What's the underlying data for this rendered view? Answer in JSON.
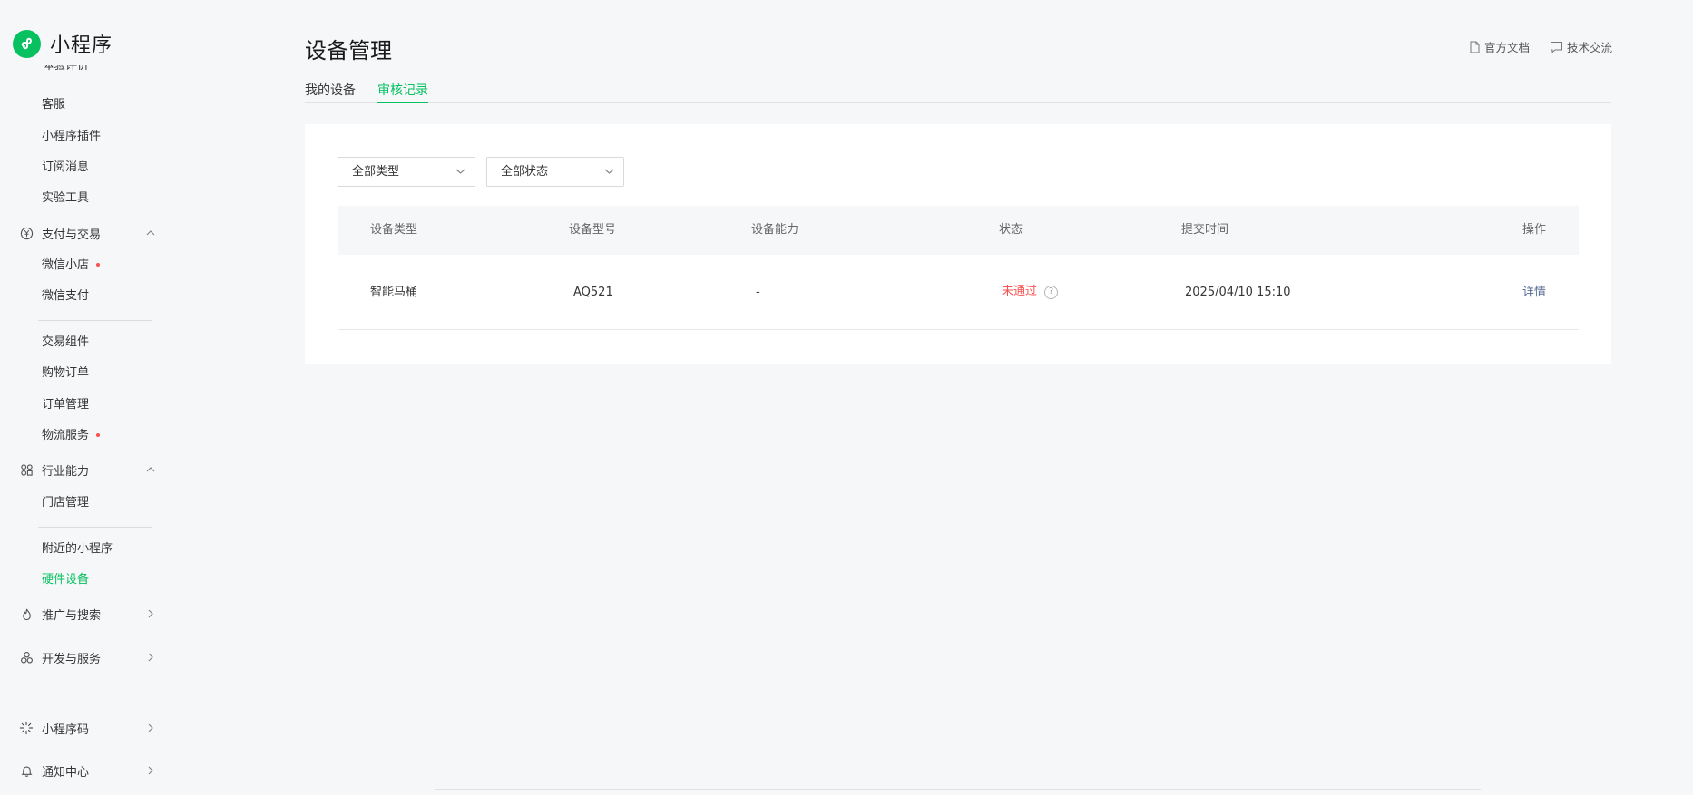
{
  "app": {
    "name": "小程序",
    "brand_color": "#07c160"
  },
  "sidebar": {
    "clipped_item": "体验评价",
    "items": {
      "kefu": "客服",
      "plugin": "小程序插件",
      "subscribe": "订阅消息",
      "lab": "实验工具",
      "shop": "微信小店",
      "pay": "微信支付",
      "trade_component": "交易组件",
      "shopping_order": "购物订单",
      "order_mgmt": "订单管理",
      "logistics": "物流服务",
      "store_mgmt": "门店管理",
      "nearby": "附近的小程序",
      "hardware": "硬件设备"
    },
    "groups": {
      "payment": "支付与交易",
      "industry": "行业能力",
      "promotion": "推广与搜索",
      "dev": "开发与服务",
      "code": "小程序码",
      "notice": "通知中心"
    }
  },
  "header": {
    "title": "设备管理",
    "links": {
      "docs": "官方文档",
      "community": "技术交流"
    }
  },
  "tabs": {
    "my_devices": "我的设备",
    "review_records": "审核记录"
  },
  "filters": {
    "type": "全部类型",
    "status": "全部状态"
  },
  "table": {
    "headers": {
      "type": "设备类型",
      "model": "设备型号",
      "capability": "设备能力",
      "status": "状态",
      "time": "提交时间",
      "action": "操作"
    },
    "rows": [
      {
        "type": "智能马桶",
        "model": "AQ521",
        "capability": "-",
        "status": "未通过",
        "time": "2025/04/10 15:10",
        "action": "详情"
      }
    ]
  },
  "colors": {
    "accent": "#07c160",
    "error": "#fa5151",
    "link": "#576b95"
  }
}
